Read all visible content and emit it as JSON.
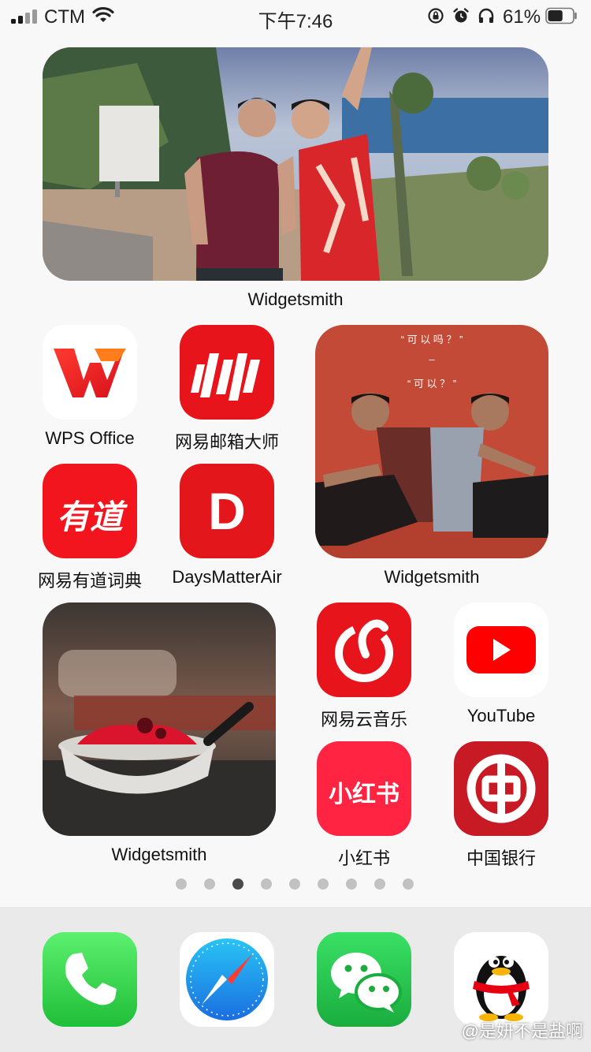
{
  "status_bar": {
    "carrier": "CTM",
    "time": "下午7:46",
    "battery_percent": "61%",
    "battery_level": 0.61
  },
  "widgets": [
    {
      "label": "Widgetsmith"
    },
    {
      "label": "Widgetsmith",
      "caption_top": "“ 可 以 吗 ？ ”",
      "caption_dash": "–",
      "caption_bottom": "“ 可 以 ？ ”"
    },
    {
      "label": "Widgetsmith"
    }
  ],
  "apps": [
    {
      "label": "WPS Office",
      "icon": "wps-office-icon"
    },
    {
      "label": "网易邮箱大师",
      "icon": "netease-mail-icon"
    },
    {
      "label": "网易有道词典",
      "icon": "youdao-dict-icon",
      "glyph": "有道"
    },
    {
      "label": "DaysMatterAir",
      "icon": "daysmatter-icon",
      "glyph": "D"
    },
    {
      "label": "网易云音乐",
      "icon": "netease-music-icon"
    },
    {
      "label": "YouTube",
      "icon": "youtube-icon"
    },
    {
      "label": "小红书",
      "icon": "xiaohongshu-icon",
      "glyph": "小红书"
    },
    {
      "label": "中国银行",
      "icon": "bank-of-china-icon"
    }
  ],
  "page_dots": {
    "count": 9,
    "active_index": 2
  },
  "dock": [
    {
      "icon": "phone-icon"
    },
    {
      "icon": "safari-icon"
    },
    {
      "icon": "wechat-icon"
    },
    {
      "icon": "qq-icon"
    }
  ],
  "watermark": "@是妍不是盐啊",
  "colors": {
    "red": "#e8141c",
    "green": "#2fc84a",
    "youtube_red": "#ff0000"
  }
}
